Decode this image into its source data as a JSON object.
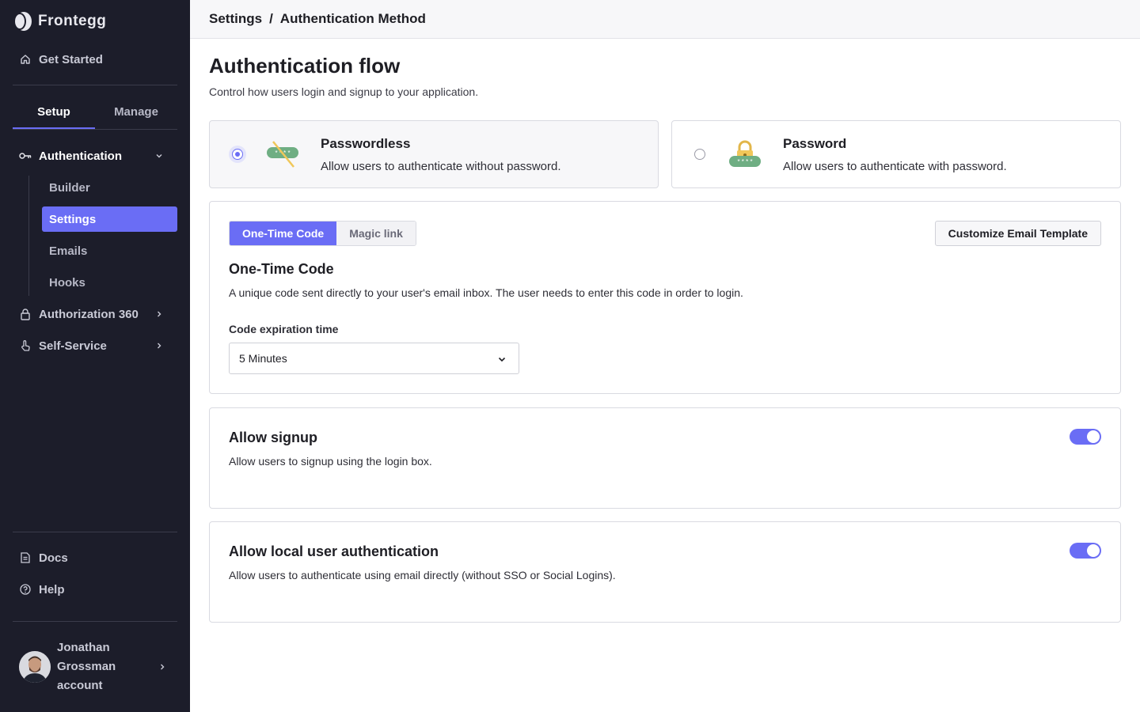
{
  "app": {
    "name": "Frontegg"
  },
  "sidebar": {
    "get_started": "Get Started",
    "tabs": [
      {
        "label": "Setup",
        "active": true
      },
      {
        "label": "Manage",
        "active": false
      }
    ],
    "authentication": "Authentication",
    "sub_items": [
      {
        "label": "Builder",
        "active": false
      },
      {
        "label": "Settings",
        "active": true
      },
      {
        "label": "Emails",
        "active": false
      },
      {
        "label": "Hooks",
        "active": false
      }
    ],
    "authorization": "Authorization 360",
    "self_service": "Self-Service",
    "docs": "Docs",
    "help": "Help",
    "user": {
      "name": "Jonathan Grossman account"
    }
  },
  "breadcrumb": {
    "root": "Settings",
    "separator": "/",
    "current": "Authentication Method"
  },
  "page": {
    "title": "Authentication flow",
    "subtitle": "Control how users login and signup to your application."
  },
  "methods": {
    "passwordless": {
      "title": "Passwordless",
      "desc": "Allow users to authenticate without password.",
      "selected": true
    },
    "password": {
      "title": "Password",
      "desc": "Allow users to authenticate with password.",
      "selected": false
    }
  },
  "otc_panel": {
    "segments": [
      "One-Time Code",
      "Magic link"
    ],
    "customize_button": "Customize Email Template",
    "title": "One-Time Code",
    "desc": "A unique code sent directly to your user's email inbox. The user needs to enter this code in order to login.",
    "field_label": "Code expiration time",
    "field_value": "5 Minutes"
  },
  "signup_panel": {
    "title": "Allow signup",
    "desc": "Allow users to signup using the login box.",
    "enabled": true
  },
  "local_auth_panel": {
    "title": "Allow local user authentication",
    "desc": "Allow users to authenticate using email directly (without SSO or Social Logins).",
    "enabled": true
  },
  "colors": {
    "accent": "#6a6df5",
    "sidebar_bg": "#1c1d2a"
  }
}
